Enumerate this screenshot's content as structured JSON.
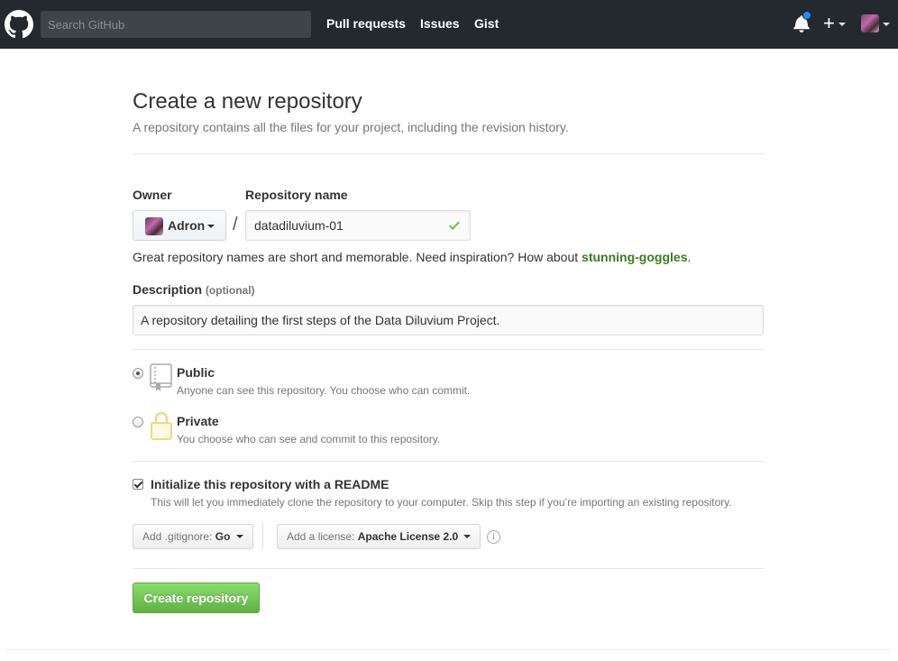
{
  "header": {
    "search_placeholder": "Search GitHub",
    "nav": [
      "Pull requests",
      "Issues",
      "Gist"
    ],
    "plus_label": "+"
  },
  "page": {
    "title": "Create a new repository",
    "subtitle": "A repository contains all the files for your project, including the revision history."
  },
  "form": {
    "owner_label": "Owner",
    "owner_name": "Adron",
    "repo_label": "Repository name",
    "separator": "/",
    "repo_value": "datadiluvium-01",
    "hint_prefix": "Great repository names are short and memorable. Need inspiration? How about ",
    "hint_suggestion": "stunning-goggles",
    "hint_suffix": ".",
    "description_label": "Description",
    "description_optional": "(optional)",
    "description_value": "A repository detailing the first steps of the Data Diluvium Project.",
    "visibility": {
      "selected": "public",
      "public_title": "Public",
      "public_note": "Anyone can see this repository. You choose who can commit.",
      "private_title": "Private",
      "private_note": "You choose who can see and commit to this repository."
    },
    "readme": {
      "checked": true,
      "title": "Initialize this repository with a README",
      "note": "This will let you immediately clone the repository to your computer. Skip this step if you’re importing an existing repository."
    },
    "gitignore_prefix": "Add .gitignore:",
    "gitignore_value": "Go",
    "license_prefix": "Add a license:",
    "license_value": "Apache License 2.0",
    "info_glyph": "i",
    "submit_label": "Create repository"
  },
  "colors": {
    "header_bg": "#24292e",
    "suggestion": "#3c7a23",
    "primary_button": "#60b044",
    "notification_dot": "#2188ff",
    "private_lock": "#f0d88a"
  }
}
